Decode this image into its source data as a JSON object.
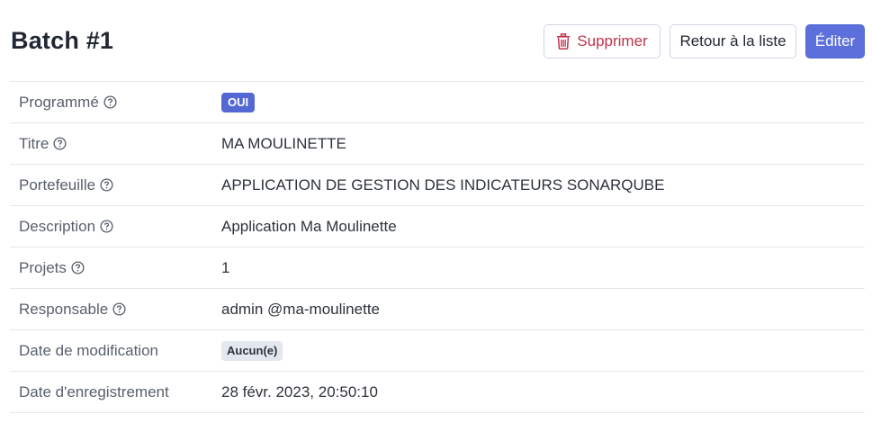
{
  "page": {
    "title": "Batch #1"
  },
  "actions": {
    "delete_label": "Supprimer",
    "back_label": "Retour à la liste",
    "edit_label": "Éditer"
  },
  "details": {
    "programmed": {
      "label": "Programmé",
      "value": "OUI"
    },
    "title": {
      "label": "Titre",
      "value": "MA MOULINETTE"
    },
    "portfolio": {
      "label": "Portefeuille",
      "value": "APPLICATION DE GESTION DES INDICATEURS SONARQUBE"
    },
    "description": {
      "label": "Description",
      "value": "Application Ma Moulinette"
    },
    "projects": {
      "label": "Projets",
      "value": "1"
    },
    "owner": {
      "label": "Responsable",
      "value": "admin @ma-moulinette"
    },
    "modified": {
      "label": "Date de modification",
      "value": "Aucun(e)"
    },
    "registered": {
      "label": "Date d'enregistrement",
      "value": "28 févr. 2023, 20:50:10"
    }
  },
  "icons": {
    "delete": "trash-icon",
    "help": "question-circle-icon"
  },
  "colors": {
    "primary": "#5d6fdb",
    "danger": "#c0334d",
    "border": "#e3e7ed",
    "label": "#58606c"
  }
}
